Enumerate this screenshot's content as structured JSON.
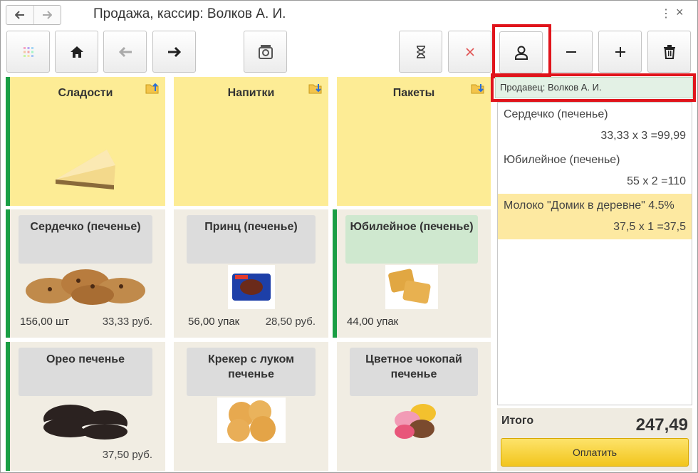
{
  "window": {
    "title": "Продажа, кассир: Волков А. И."
  },
  "groups": [
    {
      "name": "Сладости"
    },
    {
      "name": "Напитки"
    },
    {
      "name": "Пакеты"
    }
  ],
  "items": [
    {
      "name": "Сердечко (печенье)",
      "qty": "156,00 шт",
      "price": "33,33 руб."
    },
    {
      "name": "Принц (печенье)",
      "qty": "56,00 упак",
      "price": "28,50 руб."
    },
    {
      "name": "Юбилейное (печенье)",
      "qty": "44,00 упак",
      "price": ""
    },
    {
      "name": "Орео печенье",
      "qty": "",
      "price": "37,50 руб."
    },
    {
      "name": "Крекер с луком печенье",
      "qty": "",
      "price": ""
    },
    {
      "name": "Цветное чокопай печенье",
      "qty": "",
      "price": ""
    }
  ],
  "seller": "Продавец: Волков А. И.",
  "receipt": [
    {
      "name": "Сердечко (печенье)",
      "sum": "33,33 х 3 =99,99"
    },
    {
      "name": "Юбилейное (печенье)",
      "sum": "55 х 2 =110"
    },
    {
      "name": "Молоко \"Домик в деревне\" 4.5%",
      "sum": "37,5 х 1 =37,5"
    }
  ],
  "total": {
    "label": "Итого",
    "value": "247,49"
  },
  "pay_label": "Оплатить",
  "colors": {
    "group_tile": "#fdec95",
    "item_tile": "#f1ede3",
    "accent_stripe": "#1a9e44",
    "highlight": "#e0141b",
    "pay_button": "#f2c51d",
    "selected_row": "#fde9a1"
  }
}
